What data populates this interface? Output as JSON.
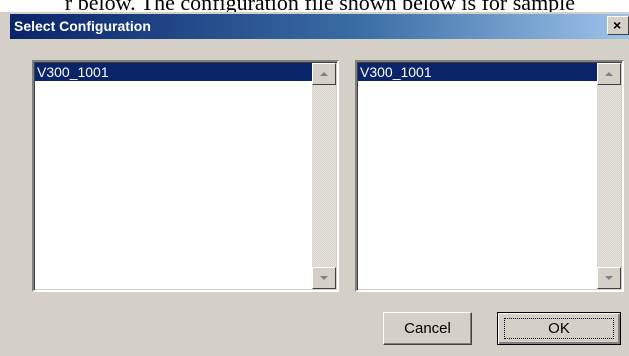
{
  "background_doc": {
    "text": "r below.  The configuration file shown below is for sample"
  },
  "dialog": {
    "title": "Select Configuration",
    "close_glyph": "✕"
  },
  "left_list": {
    "items": [
      "V300_1001"
    ],
    "selected_index": 0
  },
  "right_list": {
    "items": [
      "V300_1001"
    ],
    "selected_index": 0
  },
  "buttons": {
    "cancel_label": "Cancel",
    "ok_label": "OK"
  },
  "colors": {
    "titlebar_start": "#0a246a",
    "titlebar_end": "#a6caf0",
    "selection": "#0a246a",
    "face": "#d4d0c8"
  },
  "icons": [
    "close-icon",
    "scroll-up-arrow-icon",
    "scroll-down-arrow-icon"
  ]
}
